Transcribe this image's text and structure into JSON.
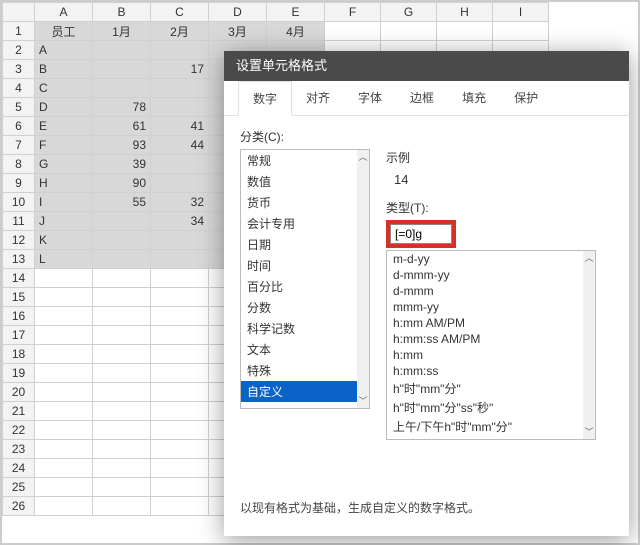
{
  "sheet": {
    "columns": [
      "A",
      "B",
      "C",
      "D",
      "E",
      "F",
      "G",
      "H",
      "I"
    ],
    "header": {
      "A": "员工",
      "B": "1月",
      "C": "2月",
      "D": "3月",
      "E": "4月"
    },
    "rows": [
      {
        "n": 1,
        "A": "员工",
        "B": "1月",
        "C": "2月",
        "D": "3月",
        "E": "4月"
      },
      {
        "n": 2,
        "A": "A"
      },
      {
        "n": 3,
        "A": "B",
        "C": "17"
      },
      {
        "n": 4,
        "A": "C"
      },
      {
        "n": 5,
        "A": "D",
        "B": "78"
      },
      {
        "n": 6,
        "A": "E",
        "B": "61",
        "C": "41"
      },
      {
        "n": 7,
        "A": "F",
        "B": "93",
        "C": "44"
      },
      {
        "n": 8,
        "A": "G",
        "B": "39"
      },
      {
        "n": 9,
        "A": "H",
        "B": "90"
      },
      {
        "n": 10,
        "A": "I",
        "B": "55",
        "C": "32"
      },
      {
        "n": 11,
        "A": "J",
        "C": "34"
      },
      {
        "n": 12,
        "A": "K"
      },
      {
        "n": 13,
        "A": "L"
      }
    ],
    "blank_rows": [
      14,
      15,
      16,
      17,
      18,
      19,
      20,
      21,
      22,
      23,
      24,
      25,
      26
    ]
  },
  "dialog": {
    "title": "设置单元格格式",
    "tabs": [
      "数字",
      "对齐",
      "字体",
      "边框",
      "填充",
      "保护"
    ],
    "active_tab": 0,
    "category_label": "分类(C):",
    "categories": [
      "常规",
      "数值",
      "货币",
      "会计专用",
      "日期",
      "时间",
      "百分比",
      "分数",
      "科学记数",
      "文本",
      "特殊",
      "自定义"
    ],
    "selected_category": 11,
    "sample_label": "示例",
    "sample_value": "14",
    "type_label": "类型(T):",
    "type_input": "[=0]g",
    "formats": [
      "m-d-yy",
      "d-mmm-yy",
      "d-mmm",
      "mmm-yy",
      "h:mm AM/PM",
      "h:mm:ss AM/PM",
      "h:mm",
      "h:mm:ss",
      "h\"时\"mm\"分\"",
      "h\"时\"mm\"分\"ss\"秒\"",
      "上午/下午h\"时\"mm\"分\""
    ],
    "hint": "以现有格式为基础，生成自定义的数字格式。",
    "scroll_up": "︿",
    "scroll_down": "﹀"
  }
}
